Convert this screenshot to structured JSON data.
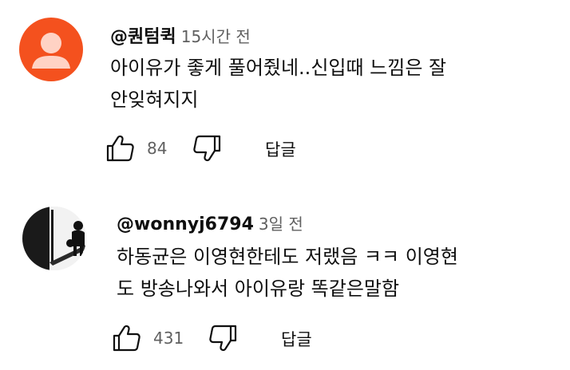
{
  "comments": [
    {
      "author": "@퀀텀퀵",
      "time": "15시간 전",
      "text_lines": [
        "아이유가 좋게 풀어줬네..신입때 느낌은 잘",
        "안잊혀지지"
      ],
      "likes": "84",
      "reply_label": "답글",
      "avatar_color": "#f4511e",
      "avatar_icon": "default-person-icon"
    },
    {
      "author": "@wonnyj6794",
      "time": "3일 전",
      "text_lines": [
        "하동균은 이영현한테도 저랬음 ㅋㅋ 이영현",
        "도 방송나와서 아이유랑 똑같은말함"
      ],
      "likes": "431",
      "reply_label": "답글",
      "avatar_icon": "silhouette-photo"
    }
  ]
}
